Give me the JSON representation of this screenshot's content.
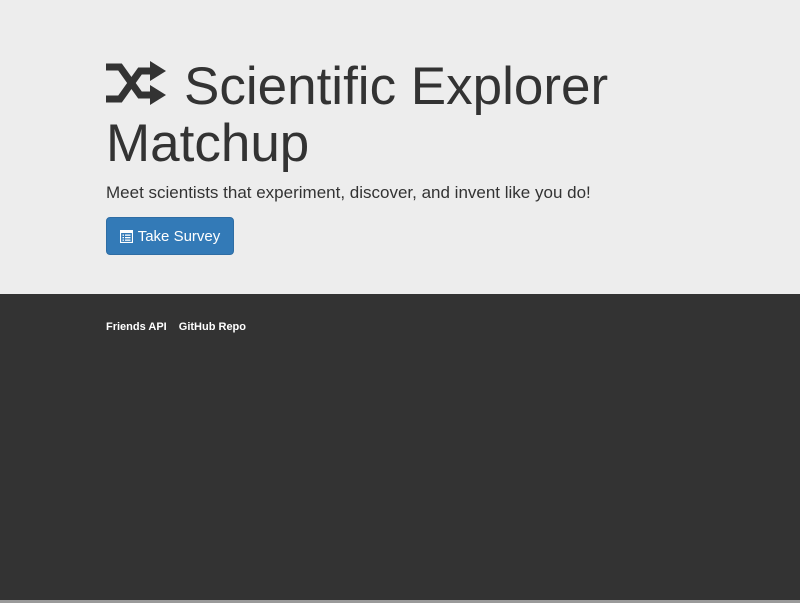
{
  "header": {
    "icon": "random-icon",
    "title": "Scientific Explorer Matchup",
    "subtitle": "Meet scientists that experiment, discover, and invent like you do!",
    "button": {
      "icon": "list-alt-icon",
      "label": "Take Survey"
    }
  },
  "footer": {
    "links": [
      {
        "label": "Friends API"
      },
      {
        "label": "GitHub Repo"
      }
    ]
  },
  "colors": {
    "jumbotron_bg": "#ededed",
    "text": "#333333",
    "primary_button": "#337ab7",
    "footer_bg": "#333333"
  }
}
